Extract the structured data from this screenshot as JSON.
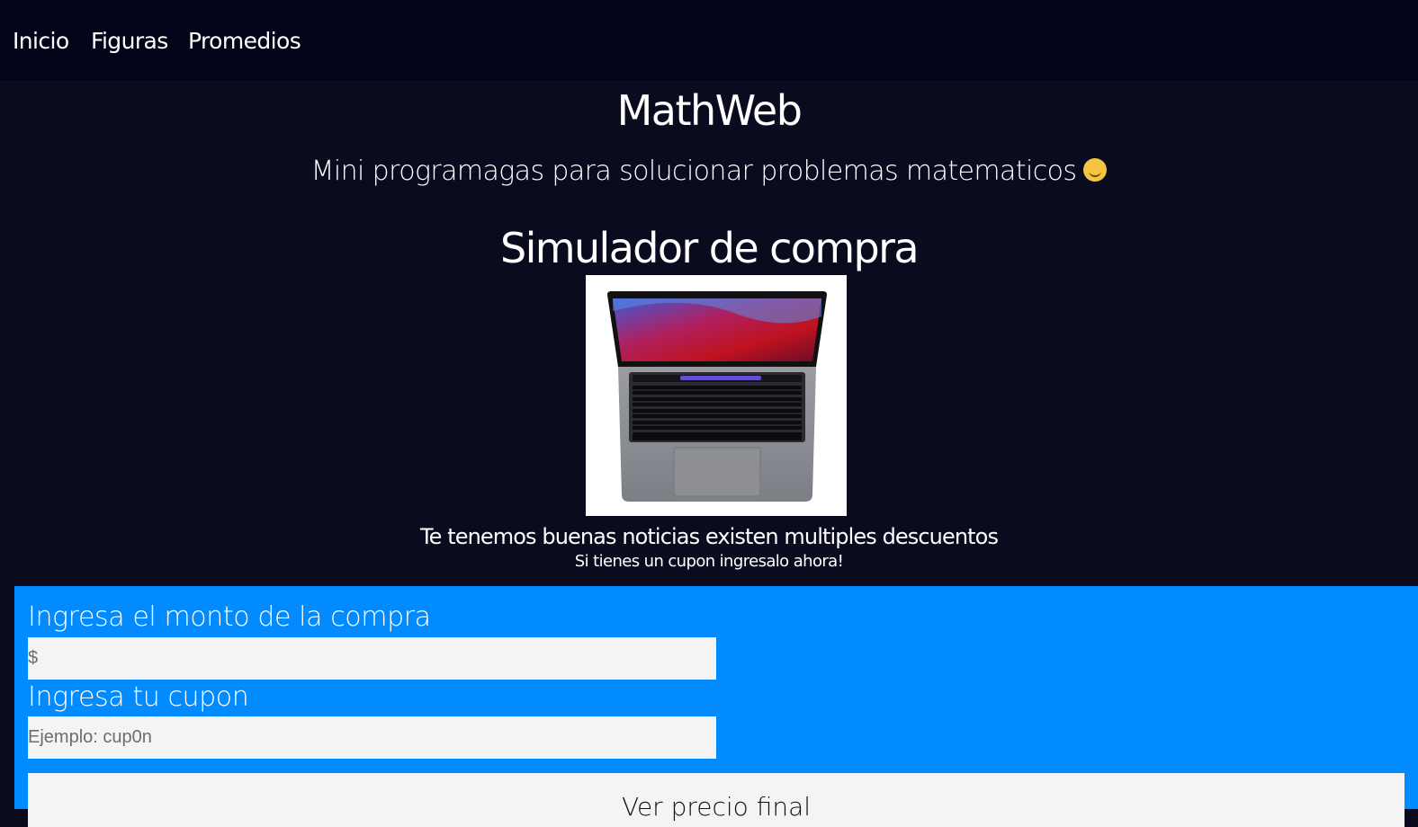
{
  "nav": {
    "items": [
      {
        "label": "Inicio"
      },
      {
        "label": "Figuras"
      },
      {
        "label": "Promedios"
      }
    ]
  },
  "header": {
    "brand": "MathWeb",
    "subtitle": "Mini programagas para solucionar problemas matematicos",
    "subtitle_icon": "smile-emoji-icon"
  },
  "simulator": {
    "title": "Simulador de compra",
    "product_image": "laptop-image",
    "news": "Te tenemos buenas noticias existen multiples descuentos",
    "news_sub": "Si tienes un cupon ingresalo ahora!"
  },
  "form": {
    "amount_label": "Ingresa el monto de la compra",
    "amount_placeholder": "$",
    "amount_value": "",
    "coupon_label": "Ingresa tu cupon",
    "coupon_placeholder": "Ejemplo: cup0n",
    "coupon_value": "",
    "submit_label": "Ver precio final"
  },
  "colors": {
    "page_bg": "#0a0b1f",
    "nav_bg": "#03041a",
    "form_bg": "#028bff",
    "field_bg": "#f4f4f4"
  }
}
